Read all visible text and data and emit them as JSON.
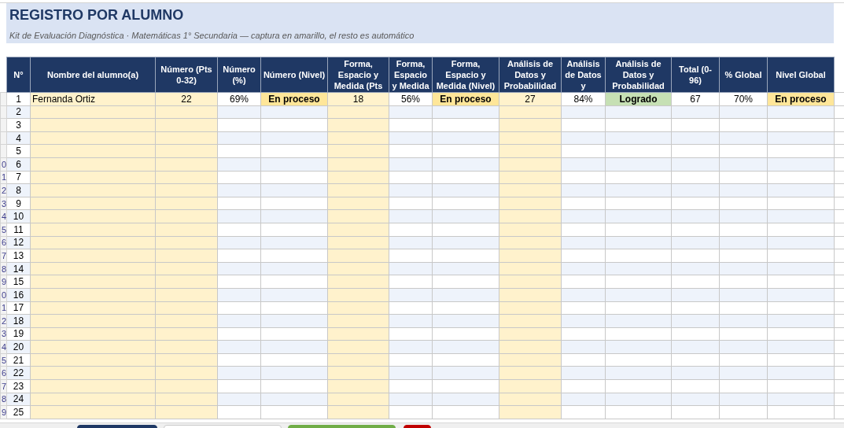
{
  "title": "REGISTRO POR ALUMNO",
  "subtitle": "Kit de Evaluación Diagnóstica · Matemáticas 1° Secundaria — captura en amarillo, el resto es automático",
  "columns": [
    {
      "label": "N°",
      "kind": "index"
    },
    {
      "label": "Nombre del alumno(a)",
      "kind": "input"
    },
    {
      "label": "Número (Pts 0-32)",
      "kind": "input"
    },
    {
      "label": "Número (%)",
      "kind": "auto"
    },
    {
      "label": "Número (Nivel)",
      "kind": "auto"
    },
    {
      "label": "Forma, Espacio y Medida (Pts",
      "kind": "input"
    },
    {
      "label": "Forma, Espacio y Medida",
      "kind": "auto"
    },
    {
      "label": "Forma, Espacio y Medida (Nivel)",
      "kind": "auto"
    },
    {
      "label": "Análisis de Datos y Probabilidad",
      "kind": "input"
    },
    {
      "label": "Análisis de Datos y",
      "kind": "auto"
    },
    {
      "label": "Análisis de Datos y Probabilidad",
      "kind": "auto"
    },
    {
      "label": "Total (0-96)",
      "kind": "auto"
    },
    {
      "label": "% Global",
      "kind": "auto"
    },
    {
      "label": "Nivel Global",
      "kind": "auto"
    }
  ],
  "rows": [
    {
      "n": "1",
      "cells": [
        {
          "text": "Fernanda Ortiz"
        },
        {
          "text": "22"
        },
        {
          "text": "69%"
        },
        {
          "text": "En proceso",
          "color": "#ffe699"
        },
        {
          "text": "18"
        },
        {
          "text": "56%"
        },
        {
          "text": "En proceso",
          "color": "#ffe699"
        },
        {
          "text": "27"
        },
        {
          "text": "84%"
        },
        {
          "text": "Logrado",
          "color": "#c6e0b4"
        },
        {
          "text": "67"
        },
        {
          "text": "70%"
        },
        {
          "text": "En proceso",
          "color": "#ffe699"
        }
      ]
    },
    {
      "n": "2"
    },
    {
      "n": "3"
    },
    {
      "n": "4"
    },
    {
      "n": "5"
    },
    {
      "n": "6",
      "row_header": "0"
    },
    {
      "n": "7",
      "row_header": "1"
    },
    {
      "n": "8",
      "row_header": "2"
    },
    {
      "n": "9",
      "row_header": "3"
    },
    {
      "n": "10",
      "row_header": "4"
    },
    {
      "n": "11",
      "row_header": "5"
    },
    {
      "n": "12",
      "row_header": "6"
    },
    {
      "n": "13",
      "row_header": "7"
    },
    {
      "n": "14",
      "row_header": "8"
    },
    {
      "n": "15",
      "row_header": "9"
    },
    {
      "n": "16",
      "row_header": "0"
    },
    {
      "n": "17",
      "row_header": "1"
    },
    {
      "n": "18",
      "row_header": "2"
    },
    {
      "n": "19",
      "row_header": "3"
    },
    {
      "n": "20",
      "row_header": "4"
    },
    {
      "n": "21",
      "row_header": "5"
    },
    {
      "n": "22",
      "row_header": "6"
    },
    {
      "n": "23",
      "row_header": "7"
    },
    {
      "n": "24",
      "row_header": "8"
    },
    {
      "n": "25",
      "row_header": "9"
    }
  ],
  "sheet_tabs": [
    {
      "color": "#1f3864",
      "selected": false
    },
    {
      "selected": true
    },
    {
      "color": "#70ad47",
      "selected": false
    },
    {
      "color": "#c00000",
      "selected": false
    }
  ]
}
